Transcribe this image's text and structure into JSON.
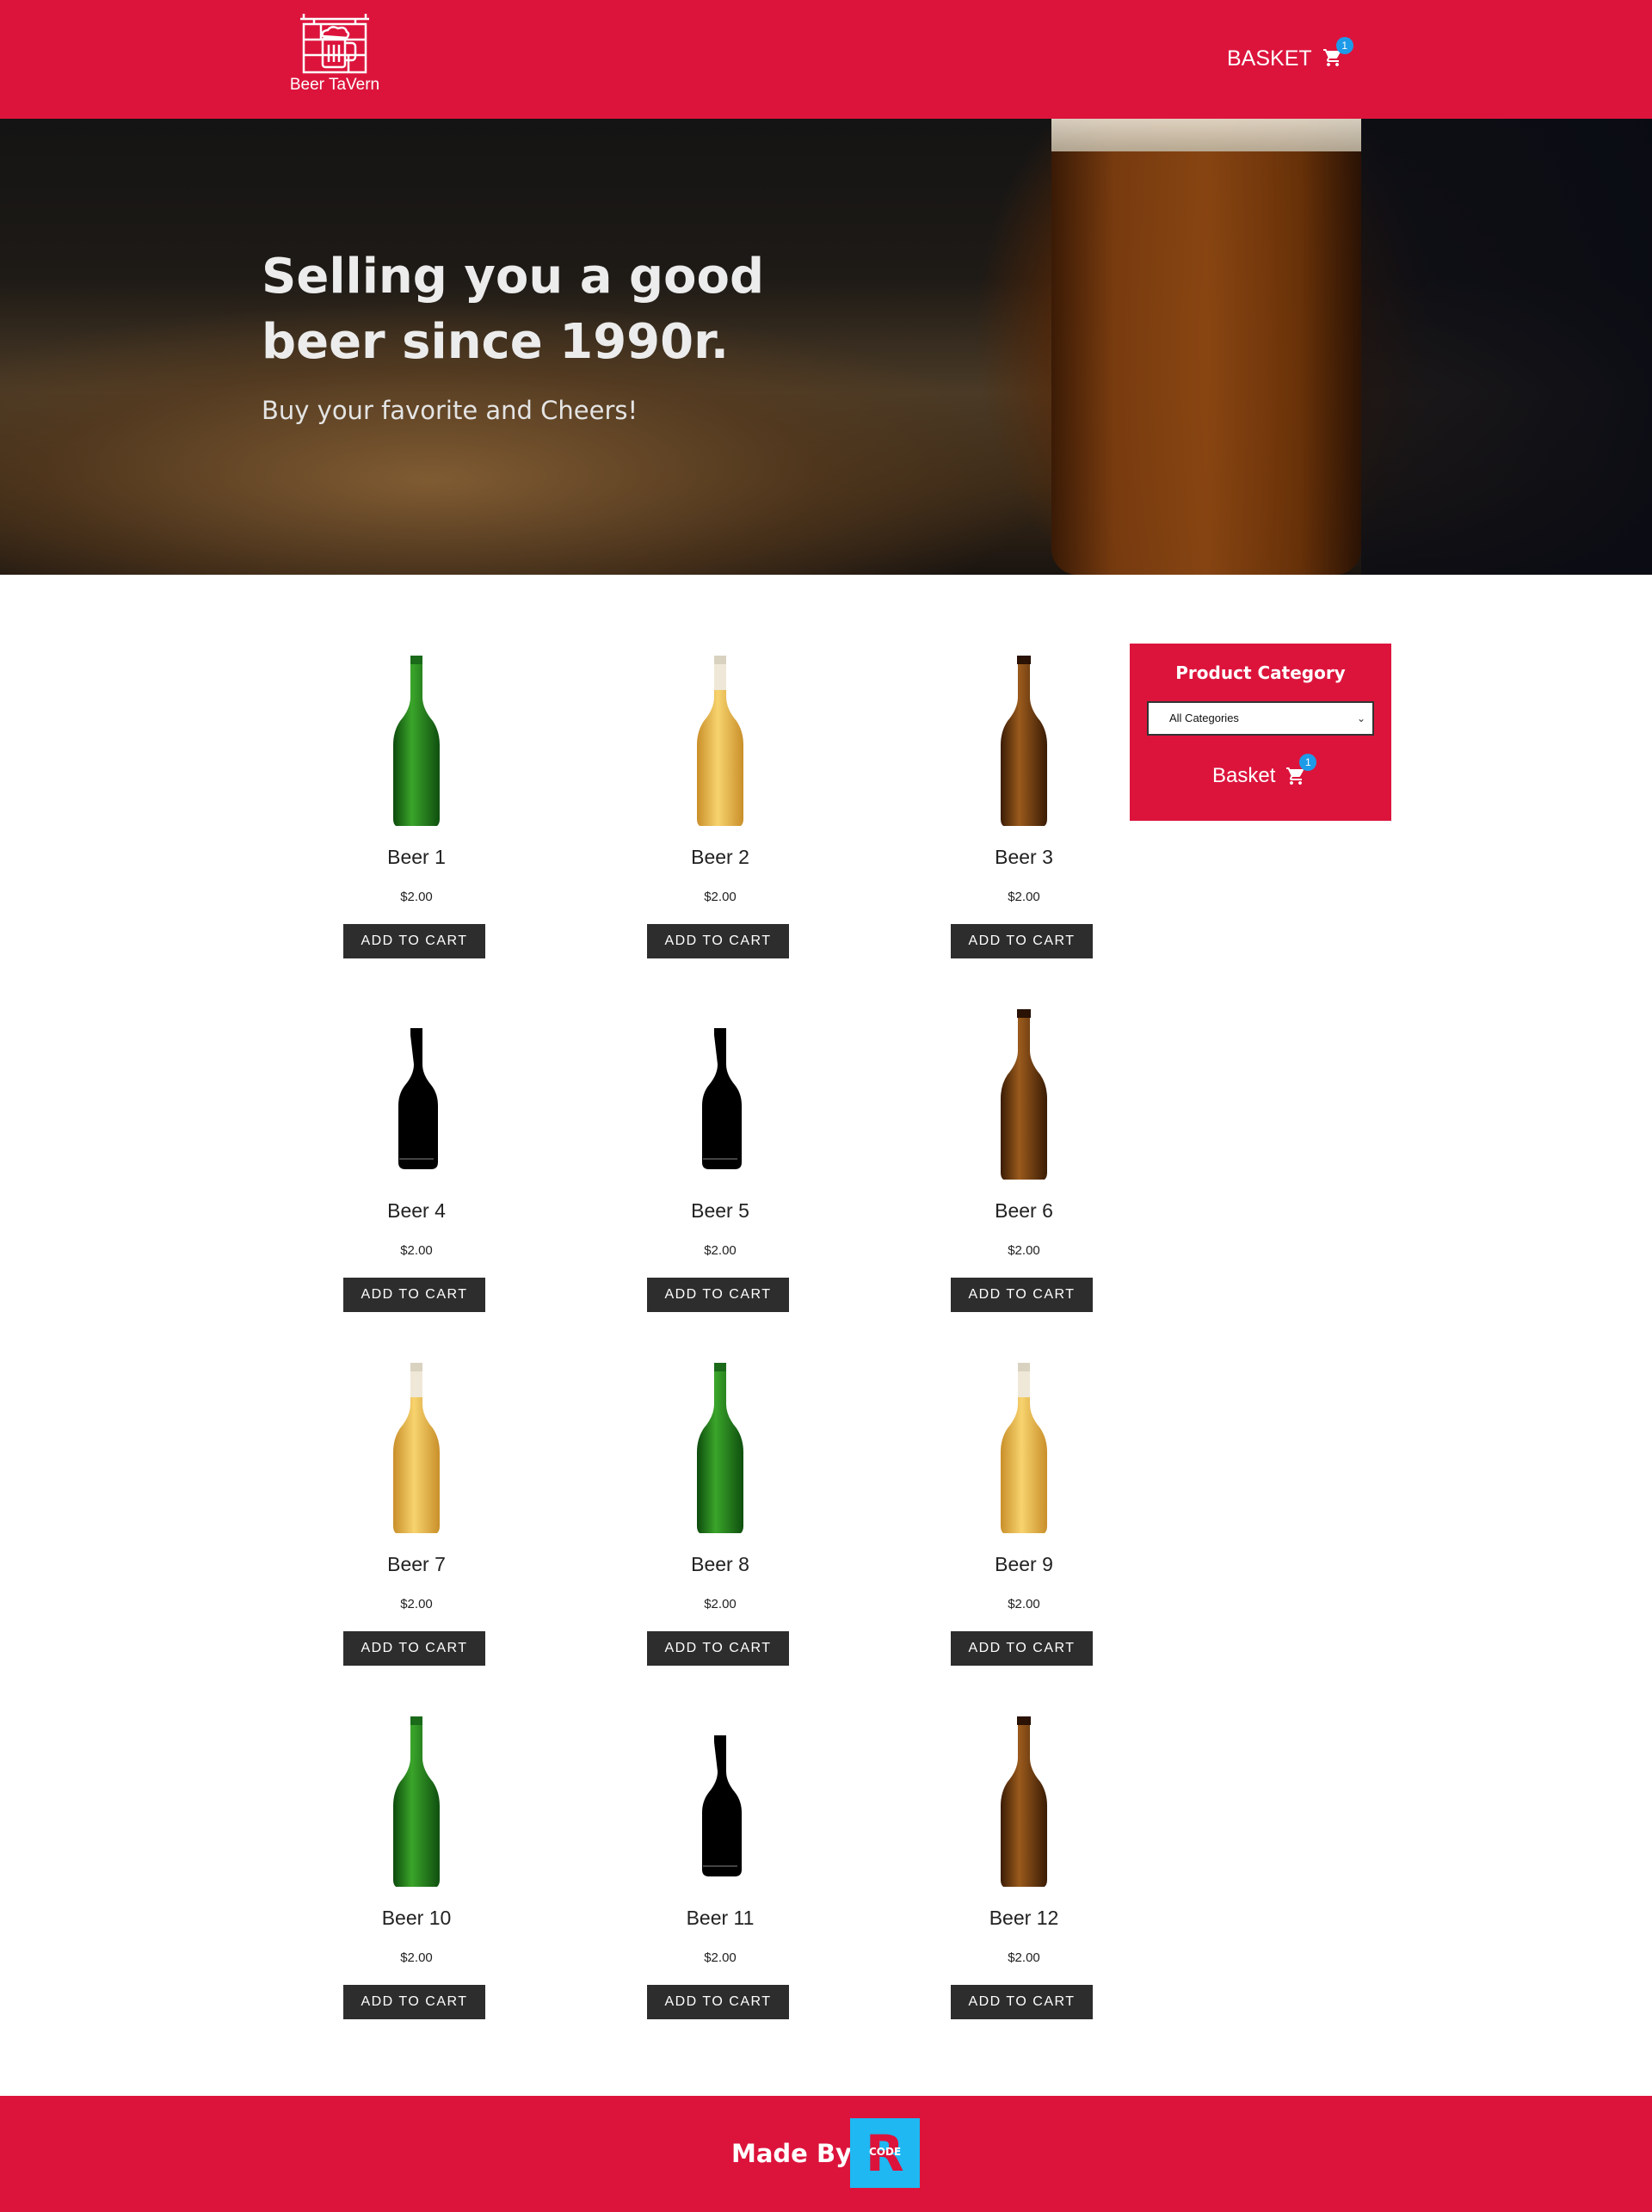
{
  "header": {
    "logo_text": "Beer TaVern",
    "basket_label": "BASKET",
    "basket_count": "1"
  },
  "hero": {
    "title": "Selling you a good beer since 1990r.",
    "subtitle": "Buy your favorite and Cheers!"
  },
  "products": [
    {
      "name": "Beer 1",
      "price": "$2.00",
      "button": "ADD TO CART",
      "bottle": "green-bottle"
    },
    {
      "name": "Beer 2",
      "price": "$2.00",
      "button": "ADD TO CART",
      "bottle": "clear-bottle"
    },
    {
      "name": "Beer 3",
      "price": "$2.00",
      "button": "ADD TO CART",
      "bottle": "brown-bottle"
    },
    {
      "name": "Beer 4",
      "price": "$2.00",
      "button": "ADD TO CART",
      "bottle": "black-bottle"
    },
    {
      "name": "Beer 5",
      "price": "$2.00",
      "button": "ADD TO CART",
      "bottle": "black-bottle"
    },
    {
      "name": "Beer 6",
      "price": "$2.00",
      "button": "ADD TO CART",
      "bottle": "brown-bottle"
    },
    {
      "name": "Beer 7",
      "price": "$2.00",
      "button": "ADD TO CART",
      "bottle": "clear-bottle"
    },
    {
      "name": "Beer 8",
      "price": "$2.00",
      "button": "ADD TO CART",
      "bottle": "green-bottle"
    },
    {
      "name": "Beer 9",
      "price": "$2.00",
      "button": "ADD TO CART",
      "bottle": "clear-bottle"
    },
    {
      "name": "Beer 10",
      "price": "$2.00",
      "button": "ADD TO CART",
      "bottle": "green-bottle"
    },
    {
      "name": "Beer 11",
      "price": "$2.00",
      "button": "ADD TO CART",
      "bottle": "black-bottle"
    },
    {
      "name": "Beer 12",
      "price": "$2.00",
      "button": "ADD TO CART",
      "bottle": "brown-bottle"
    }
  ],
  "sidebar": {
    "title": "Product Category",
    "category_selected": "All Categories",
    "basket_label": "Basket",
    "basket_count": "1"
  },
  "footer": {
    "made_by": "Made By",
    "logo_letter": "R",
    "logo_word": "CODE"
  },
  "colors": {
    "brand": "#dc143c",
    "button": "#2d2d2d",
    "badge": "#1e9be8",
    "footer_logo_bg": "#1fb8f2"
  }
}
